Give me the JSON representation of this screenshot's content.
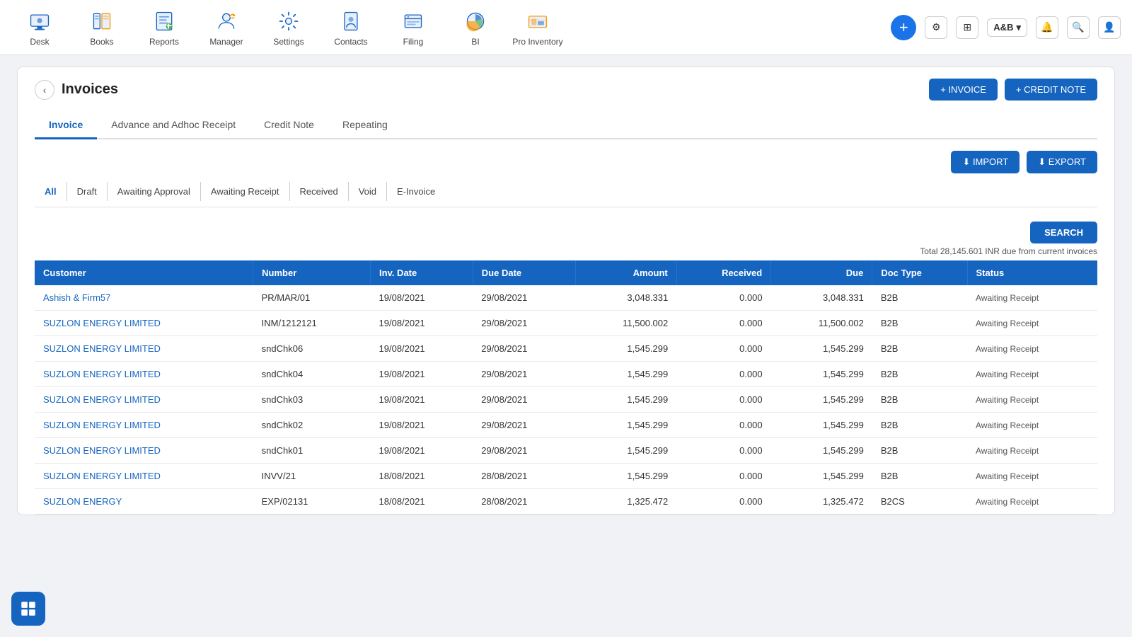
{
  "topnav": {
    "items": [
      {
        "label": "Desk",
        "icon": "desk-icon"
      },
      {
        "label": "Books",
        "icon": "books-icon"
      },
      {
        "label": "Reports",
        "icon": "reports-icon"
      },
      {
        "label": "Manager",
        "icon": "manager-icon"
      },
      {
        "label": "Settings",
        "icon": "settings-icon"
      },
      {
        "label": "Contacts",
        "icon": "contacts-icon"
      },
      {
        "label": "Filing",
        "icon": "filing-icon"
      },
      {
        "label": "BI",
        "icon": "bi-icon"
      },
      {
        "label": "Pro Inventory",
        "icon": "pro-inventory-icon"
      }
    ],
    "company": "A&B",
    "plus_btn": "+",
    "search_icon": "🔍",
    "notification_icon": "🔔",
    "profile_icon": "👤"
  },
  "page": {
    "back_label": "‹",
    "title": "Invoices",
    "btn_invoice": "+ INVOICE",
    "btn_credit_note": "+ CREDIT NOTE",
    "btn_import": "⬇ IMPORT",
    "btn_export": "⬇ EXPORT",
    "btn_search": "SEARCH"
  },
  "tabs": [
    {
      "label": "Invoice",
      "active": true
    },
    {
      "label": "Advance and Adhoc Receipt",
      "active": false
    },
    {
      "label": "Credit Note",
      "active": false
    },
    {
      "label": "Repeating",
      "active": false
    }
  ],
  "filter_tabs": [
    {
      "label": "All",
      "active": true
    },
    {
      "label": "Draft",
      "active": false
    },
    {
      "label": "Awaiting Approval",
      "active": false
    },
    {
      "label": "Awaiting Receipt",
      "active": false
    },
    {
      "label": "Received",
      "active": false
    },
    {
      "label": "Void",
      "active": false
    },
    {
      "label": "E-Invoice",
      "active": false
    }
  ],
  "total_label": "Total 28,145.601 INR due from current invoices",
  "table": {
    "headers": [
      "Customer",
      "Number",
      "Inv. Date",
      "Due Date",
      "Amount",
      "Received",
      "Due",
      "Doc Type",
      "Status"
    ],
    "rows": [
      {
        "customer": "Ashish & Firm57",
        "number": "PR/MAR/01",
        "inv_date": "19/08/2021",
        "due_date": "29/08/2021",
        "amount": "3,048.331",
        "received": "0.000",
        "due": "3,048.331",
        "doc_type": "B2B",
        "status": "Awaiting Receipt"
      },
      {
        "customer": "SUZLON ENERGY LIMITED",
        "number": "INM/1212121",
        "inv_date": "19/08/2021",
        "due_date": "29/08/2021",
        "amount": "11,500.002",
        "received": "0.000",
        "due": "11,500.002",
        "doc_type": "B2B",
        "status": "Awaiting Receipt"
      },
      {
        "customer": "SUZLON ENERGY LIMITED",
        "number": "sndChk06",
        "inv_date": "19/08/2021",
        "due_date": "29/08/2021",
        "amount": "1,545.299",
        "received": "0.000",
        "due": "1,545.299",
        "doc_type": "B2B",
        "status": "Awaiting Receipt"
      },
      {
        "customer": "SUZLON ENERGY LIMITED",
        "number": "sndChk04",
        "inv_date": "19/08/2021",
        "due_date": "29/08/2021",
        "amount": "1,545.299",
        "received": "0.000",
        "due": "1,545.299",
        "doc_type": "B2B",
        "status": "Awaiting Receipt"
      },
      {
        "customer": "SUZLON ENERGY LIMITED",
        "number": "sndChk03",
        "inv_date": "19/08/2021",
        "due_date": "29/08/2021",
        "amount": "1,545.299",
        "received": "0.000",
        "due": "1,545.299",
        "doc_type": "B2B",
        "status": "Awaiting Receipt"
      },
      {
        "customer": "SUZLON ENERGY LIMITED",
        "number": "sndChk02",
        "inv_date": "19/08/2021",
        "due_date": "29/08/2021",
        "amount": "1,545.299",
        "received": "0.000",
        "due": "1,545.299",
        "doc_type": "B2B",
        "status": "Awaiting Receipt"
      },
      {
        "customer": "SUZLON ENERGY LIMITED",
        "number": "sndChk01",
        "inv_date": "19/08/2021",
        "due_date": "29/08/2021",
        "amount": "1,545.299",
        "received": "0.000",
        "due": "1,545.299",
        "doc_type": "B2B",
        "status": "Awaiting Receipt"
      },
      {
        "customer": "SUZLON ENERGY LIMITED",
        "number": "INVV/21",
        "inv_date": "18/08/2021",
        "due_date": "28/08/2021",
        "amount": "1,545.299",
        "received": "0.000",
        "due": "1,545.299",
        "doc_type": "B2B",
        "status": "Awaiting Receipt"
      },
      {
        "customer": "SUZLON ENERGY",
        "number": "EXP/02131",
        "inv_date": "18/08/2021",
        "due_date": "28/08/2021",
        "amount": "1,325.472",
        "received": "0.000",
        "due": "1,325.472",
        "doc_type": "B2CS",
        "status": "Awaiting Receipt"
      }
    ]
  }
}
